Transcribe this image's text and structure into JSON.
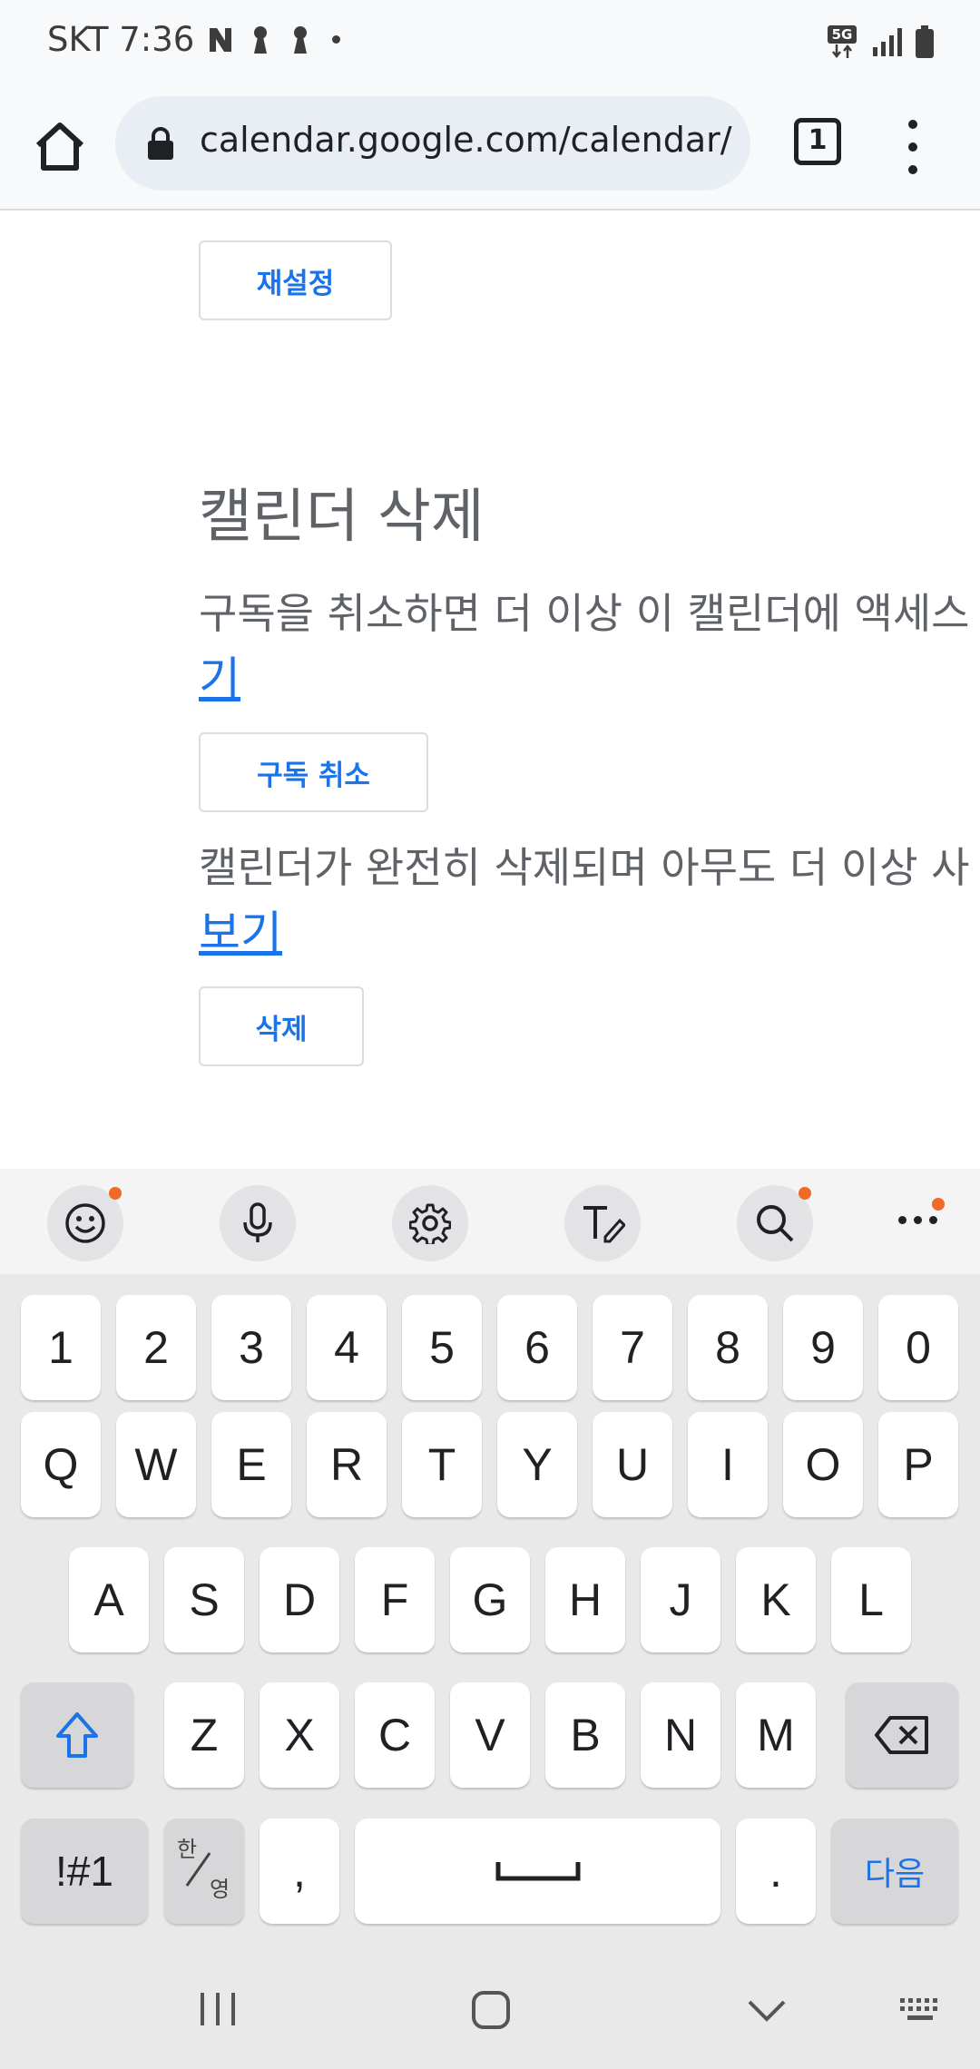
{
  "status_bar": {
    "carrier_time": "SKT 7:36",
    "network_badge": "5G"
  },
  "browser": {
    "url": "calendar.google.com/calendar/",
    "tab_count": "1"
  },
  "page": {
    "reset_button": "재설정",
    "delete_section_title": "캘린더 삭제",
    "unsubscribe_text": "구독을 취소하면 더 이상 이 캘린더에 액세스",
    "unsubscribe_link": "기",
    "unsubscribe_button": "구독 취소",
    "delete_text": "캘린더가 완전히 삭제되며 아무도 더 이상 사",
    "delete_link": "보기",
    "delete_button": "삭제"
  },
  "keyboard": {
    "toolbar": [
      "emoji-icon",
      "microphone-icon",
      "gear-icon",
      "handwriting-icon",
      "search-icon",
      "more-icon"
    ],
    "row_numbers": [
      "1",
      "2",
      "3",
      "4",
      "5",
      "6",
      "7",
      "8",
      "9",
      "0"
    ],
    "row_1": [
      "Q",
      "W",
      "E",
      "R",
      "T",
      "Y",
      "U",
      "I",
      "O",
      "P"
    ],
    "row_2": [
      "A",
      "S",
      "D",
      "F",
      "G",
      "H",
      "J",
      "K",
      "L"
    ],
    "row_3": [
      "Z",
      "X",
      "C",
      "V",
      "B",
      "N",
      "M"
    ],
    "symbols_key": "!#1",
    "lang_key_top": "한",
    "lang_key_bottom": "영",
    "comma_key": ",",
    "period_key": ".",
    "next_key": "다음"
  },
  "colors": {
    "accent": "#1a73e8",
    "notification_dot": "#f06a28"
  }
}
